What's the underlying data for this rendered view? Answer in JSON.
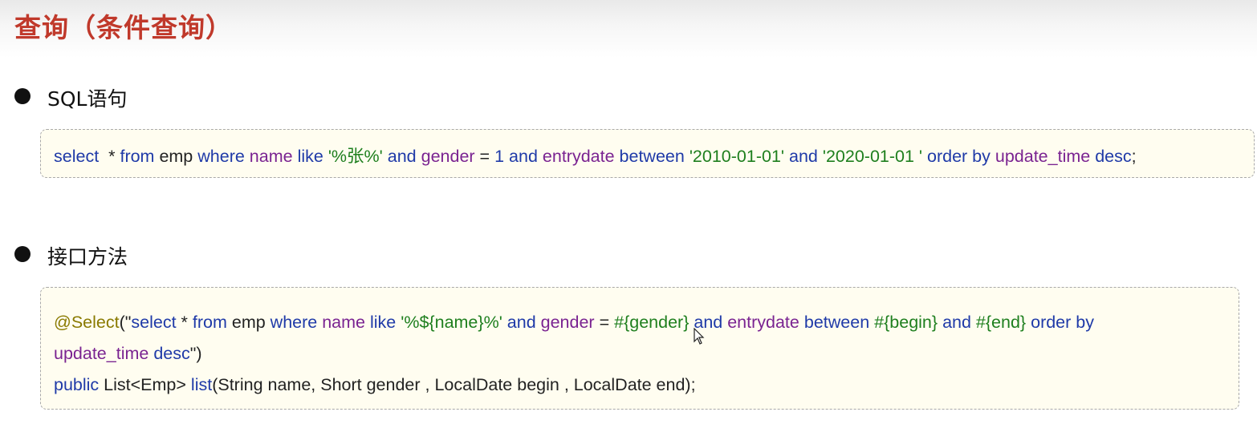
{
  "title": "查询（条件查询）",
  "sections": [
    {
      "label": "SQL语句"
    },
    {
      "label": "接口方法"
    }
  ],
  "sql_code": {
    "tokens": [
      {
        "t": "select",
        "c": "kw"
      },
      {
        "t": "  * ",
        "c": "txt"
      },
      {
        "t": "from",
        "c": "kw"
      },
      {
        "t": " emp ",
        "c": "txt"
      },
      {
        "t": "where",
        "c": "kw"
      },
      {
        "t": " ",
        "c": "txt"
      },
      {
        "t": "name",
        "c": "fld"
      },
      {
        "t": " ",
        "c": "txt"
      },
      {
        "t": "like",
        "c": "kw"
      },
      {
        "t": " ",
        "c": "txt"
      },
      {
        "t": "'%张%'",
        "c": "str"
      },
      {
        "t": " ",
        "c": "txt"
      },
      {
        "t": "and",
        "c": "kw"
      },
      {
        "t": " ",
        "c": "txt"
      },
      {
        "t": "gender",
        "c": "fld"
      },
      {
        "t": " = ",
        "c": "txt"
      },
      {
        "t": "1",
        "c": "num"
      },
      {
        "t": " ",
        "c": "txt"
      },
      {
        "t": "and",
        "c": "kw"
      },
      {
        "t": " ",
        "c": "txt"
      },
      {
        "t": "entrydate",
        "c": "fld"
      },
      {
        "t": " ",
        "c": "txt"
      },
      {
        "t": "between",
        "c": "kw"
      },
      {
        "t": " ",
        "c": "txt"
      },
      {
        "t": "'2010-01-01'",
        "c": "str"
      },
      {
        "t": " ",
        "c": "txt"
      },
      {
        "t": "and",
        "c": "kw"
      },
      {
        "t": " ",
        "c": "txt"
      },
      {
        "t": "'2020-01-01 '",
        "c": "str"
      },
      {
        "t": " ",
        "c": "txt"
      },
      {
        "t": "order by",
        "c": "kw"
      },
      {
        "t": " ",
        "c": "txt"
      },
      {
        "t": "update_time",
        "c": "fld"
      },
      {
        "t": " ",
        "c": "txt"
      },
      {
        "t": "desc",
        "c": "kw"
      },
      {
        "t": ";",
        "c": "txt"
      }
    ]
  },
  "java_code": {
    "lines": [
      [
        {
          "t": "@Select",
          "c": "ann"
        },
        {
          "t": "(\"",
          "c": "txt"
        },
        {
          "t": "select",
          "c": "kw"
        },
        {
          "t": " * ",
          "c": "txt"
        },
        {
          "t": "from",
          "c": "kw"
        },
        {
          "t": " emp ",
          "c": "txt"
        },
        {
          "t": "where",
          "c": "kw"
        },
        {
          "t": " ",
          "c": "txt"
        },
        {
          "t": "name",
          "c": "fld"
        },
        {
          "t": " ",
          "c": "txt"
        },
        {
          "t": "like",
          "c": "kw"
        },
        {
          "t": " ",
          "c": "txt"
        },
        {
          "t": "'%${name}%'",
          "c": "str"
        },
        {
          "t": " ",
          "c": "txt"
        },
        {
          "t": "and",
          "c": "kw"
        },
        {
          "t": " ",
          "c": "txt"
        },
        {
          "t": "gender",
          "c": "fld"
        },
        {
          "t": " = ",
          "c": "txt"
        },
        {
          "t": "#{gender}",
          "c": "str"
        },
        {
          "t": " ",
          "c": "txt"
        },
        {
          "t": "and",
          "c": "kw"
        },
        {
          "t": " ",
          "c": "txt"
        },
        {
          "t": "entrydate",
          "c": "fld"
        },
        {
          "t": " ",
          "c": "txt"
        },
        {
          "t": "between",
          "c": "kw"
        },
        {
          "t": " ",
          "c": "txt"
        },
        {
          "t": "#{begin}",
          "c": "str"
        },
        {
          "t": " ",
          "c": "txt"
        },
        {
          "t": "and",
          "c": "kw"
        },
        {
          "t": " ",
          "c": "txt"
        },
        {
          "t": "#{end}",
          "c": "str"
        },
        {
          "t": " ",
          "c": "txt"
        },
        {
          "t": "order by",
          "c": "kw"
        }
      ],
      [
        {
          "t": "update_time",
          "c": "fld"
        },
        {
          "t": " ",
          "c": "txt"
        },
        {
          "t": "desc",
          "c": "kw"
        },
        {
          "t": "\")",
          "c": "txt"
        }
      ],
      [
        {
          "t": "public",
          "c": "kw"
        },
        {
          "t": " List<Emp> ",
          "c": "txt"
        },
        {
          "t": "list",
          "c": "kw"
        },
        {
          "t": "(String name, Short gender , LocalDate begin , LocalDate end);",
          "c": "txt"
        }
      ]
    ]
  },
  "colors": {
    "title": "#c0392b",
    "keyword": "#1f3aa8",
    "field": "#7a2391",
    "string": "#1e7f1e",
    "annotation": "#8a7a00",
    "code_background": "#fffdf0"
  },
  "icons": {
    "cursor": "mouse-pointer-icon",
    "bullet": "bullet-dot-icon"
  }
}
